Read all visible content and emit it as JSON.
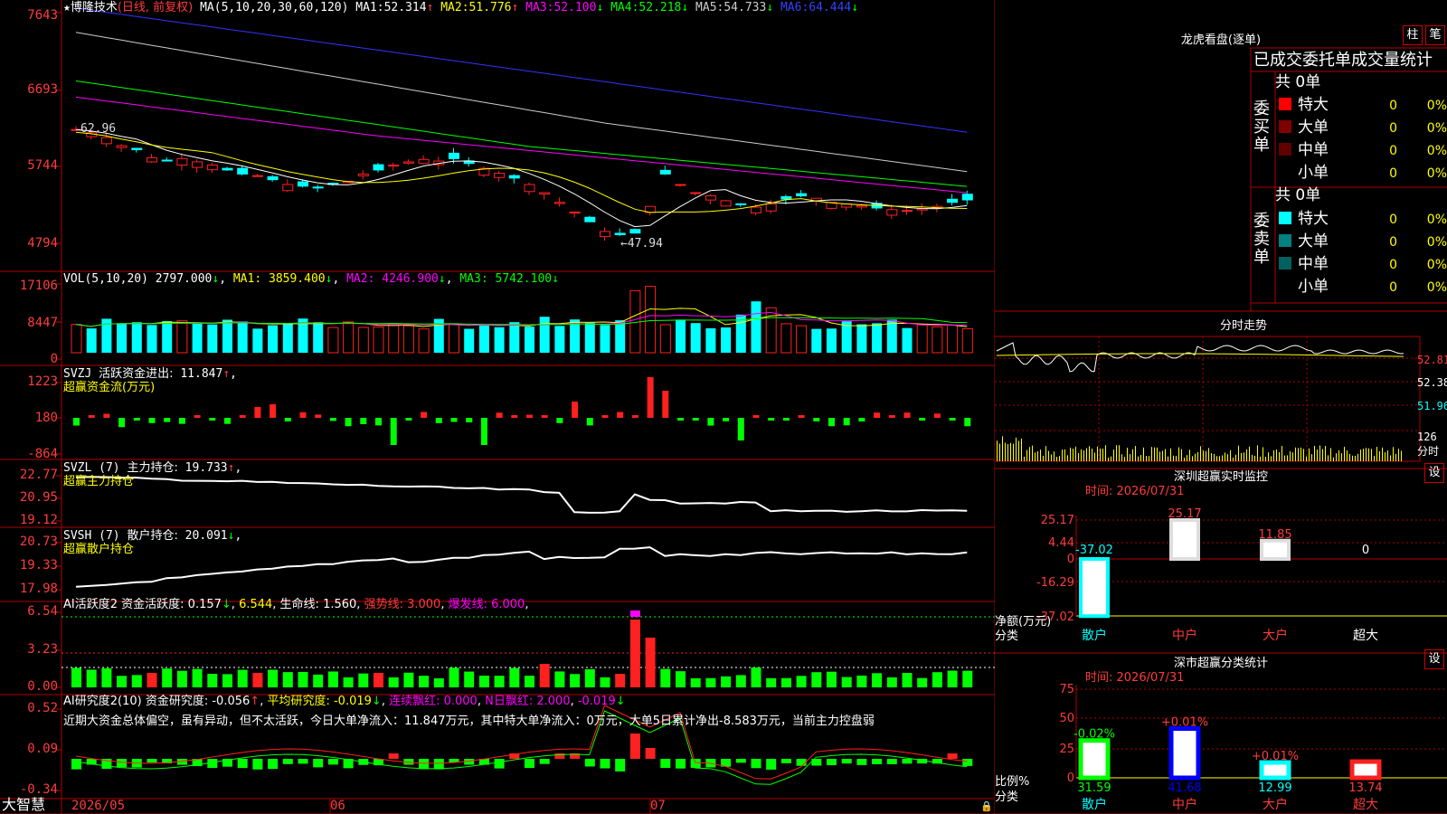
{
  "colors": {
    "up": "#ff2020",
    "down": "#00ffff",
    "green": "#00ff00",
    "ma1": "#ffffff",
    "ma2": "#ffff00",
    "ma3": "#ff00ff",
    "ma4": "#00ff00",
    "ma5": "#cccccc",
    "ma6": "#3333ff",
    "grid": "#aa0000"
  },
  "main": {
    "star": "★",
    "name": "博隆技术",
    "period": "(日线, 前复权)",
    "ma_params": "MA(5,10,20,30,60,120)",
    "ma": [
      {
        "label": "MA1:",
        "value": "52.314",
        "arrow": "↑"
      },
      {
        "label": "MA2:",
        "value": "51.776",
        "arrow": "↑"
      },
      {
        "label": "MA3:",
        "value": "52.100",
        "arrow": "↓"
      },
      {
        "label": "MA4:",
        "value": "52.218",
        "arrow": "↓"
      },
      {
        "label": "MA5:",
        "value": "54.733",
        "arrow": "↓"
      },
      {
        "label": "MA6:",
        "value": "64.444",
        "arrow": "↓"
      }
    ],
    "y_ticks": [
      "7643",
      "6693",
      "5744",
      "4794"
    ],
    "high_label": "62.96",
    "low_label": "←47.94"
  },
  "vol": {
    "label": "VOL(5,10,20)",
    "value": "2797.000",
    "arrow": "↓",
    "ma": [
      {
        "label": "MA1:",
        "value": "3859.400",
        "arrow": "↓"
      },
      {
        "label": "MA2:",
        "value": "4246.900",
        "arrow": "↓"
      },
      {
        "label": "MA3:",
        "value": "5742.100",
        "arrow": "↓"
      }
    ],
    "y_ticks": [
      "17106",
      "8447",
      "0"
    ]
  },
  "svzj": {
    "label": "SVZJ",
    "title": "活跃资金进出:",
    "value": "11.847",
    "arrow": "↑",
    "sub": "超赢资金流(万元)",
    "y_ticks": [
      "1223",
      "180",
      "-864"
    ]
  },
  "svzl": {
    "label": "SVZL (7)",
    "title": "主力持仓:",
    "value": "19.733",
    "arrow": "↑",
    "sub": "超赢主力持仓",
    "y_ticks": [
      "22.77",
      "20.95",
      "19.12"
    ]
  },
  "svsh": {
    "label": "SVSH (7)",
    "title": "散户持仓:",
    "value": "20.091",
    "arrow": "↓",
    "sub": "超赢散户持仓",
    "y_ticks": [
      "20.73",
      "19.33",
      "17.98"
    ]
  },
  "ai1": {
    "label": "AI活跃度2",
    "t1": "资金活跃度:",
    "v1": "0.157",
    "a1": "↓",
    "v2": "6.544",
    "t3": "生命线:",
    "v3": "1.560",
    "t4": "强势线:",
    "v4": "3.000",
    "t5": "爆发线:",
    "v5": "6.000",
    "y_ticks": [
      "6.54",
      "3.23",
      "0.00"
    ]
  },
  "ai2": {
    "label": "AI研究度2(10)",
    "t1": "资金研究度:",
    "v1": "-0.056",
    "a1": "↑",
    "t2": "平均研究度:",
    "v2": "-0.019",
    "a2": "↓",
    "t3": "连续飘红:",
    "v3": "0.000",
    "t4": "N日飘红:",
    "v4": "2.000",
    "v5": "-0.019",
    "a5": "↓",
    "note": "近期大资金总体偏空，虽有异动，但不太活跃，今日大单净流入：11.847万元，其中特大单净流入：0万元，大单5日累计净出-8.583万元，当前主力控盘弱",
    "y_ticks": [
      "0.52",
      "0.09",
      "-0.34"
    ]
  },
  "bottom": {
    "brand": "大智慧",
    "dates": [
      "2026/05",
      "06",
      "07"
    ]
  },
  "right": {
    "lh": {
      "title": "龙虎看盘(逐单)",
      "btn1": "柱",
      "btn2": "笔",
      "subtitle": "已成交委托单成交量统计",
      "buy": {
        "side": "委买单",
        "total": "共 0单",
        "rows": [
          {
            "name": "特大",
            "n": "0",
            "p": "0%"
          },
          {
            "name": "大单",
            "n": "0",
            "p": "0%"
          },
          {
            "name": "中单",
            "n": "0",
            "p": "0%"
          },
          {
            "name": "小单",
            "n": "0",
            "p": "0%"
          }
        ]
      },
      "sell": {
        "side": "委卖单",
        "total": "共 0单",
        "rows": [
          {
            "name": "特大",
            "n": "0",
            "p": "0%"
          },
          {
            "name": "大单",
            "n": "0",
            "p": "0%"
          },
          {
            "name": "中单",
            "n": "0",
            "p": "0%"
          },
          {
            "name": "小单",
            "n": "0",
            "p": "0%"
          }
        ]
      }
    },
    "fs": {
      "title": "分时走势",
      "p1": "52.81",
      "p2": "52.38",
      "p3": "51.96",
      "v1": "126",
      "v2": "分时"
    },
    "sz": {
      "title": "深圳超赢实时监控",
      "btn": "设",
      "time": "时间: 2026/07/31",
      "y_ticks": [
        "25.17",
        "4.44",
        "0",
        "-16.29",
        "-37.02"
      ],
      "ylabel": "净额(万元)",
      "xlabel": "分类",
      "bars": [
        {
          "cat": "散户",
          "value": "-37.02"
        },
        {
          "cat": "中户",
          "value": "25.17"
        },
        {
          "cat": "大户",
          "value": "11.85"
        },
        {
          "cat": "超大",
          "value": "0"
        }
      ]
    },
    "sc": {
      "title": "深市超赢分类统计",
      "btn": "设",
      "time": "时间: 2026/07/31",
      "y_ticks": [
        "75",
        "50",
        "25",
        "0"
      ],
      "ylabel": "比例%",
      "xlabel": "分类",
      "bars": [
        {
          "cat": "散户",
          "value": "31.59",
          "chg": "-0.02%"
        },
        {
          "cat": "中户",
          "value": "41.68",
          "chg": "+0.01%"
        },
        {
          "cat": "大户",
          "value": "12.99",
          "chg": "+0.01%"
        },
        {
          "cat": "超大",
          "value": "13.74",
          "chg": ""
        }
      ]
    }
  }
}
